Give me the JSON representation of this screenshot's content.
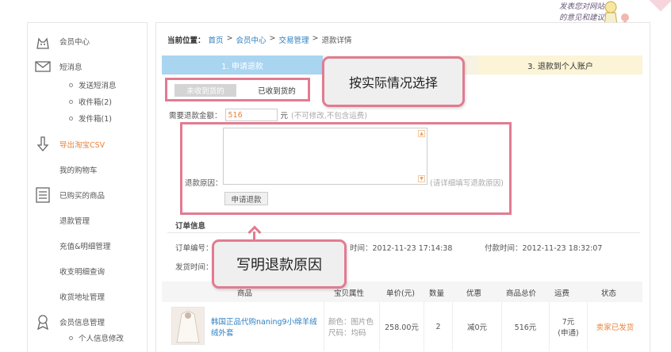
{
  "feedback": {
    "line1": "发表您对网站",
    "line2": "的意见和建议"
  },
  "sidebar": {
    "member_center": "会员中心",
    "messages": "短消息",
    "msg_sent": "发送短消息",
    "msg_inbox": "收件箱(2)",
    "msg_outbox": "发件箱(1)",
    "export_csv": "导出淘宝CSV",
    "cart": "我的购物车",
    "bought": "已购买的商品",
    "refund_manage": "退款管理",
    "recharge": "充值&明细管理",
    "payments": "收支明细查询",
    "address": "收货地址管理",
    "profile": "会员信息管理",
    "profile_edit": "个人信息修改"
  },
  "breadcrumb": {
    "label": "当前位置：",
    "home": "首页",
    "member": "会员中心",
    "trade": "交易管理",
    "current": "退款详情",
    "sep": ">"
  },
  "steps": {
    "step1": "1. 申请退款",
    "step3": "3. 退款到个人账户"
  },
  "tabs": {
    "not_received": "未收到货的",
    "received": "已收到货的"
  },
  "callouts": {
    "choose": "按实际情况选择",
    "reason": "写明退款原因"
  },
  "refund": {
    "amount_label": "需要退款金额：",
    "amount_value": "516",
    "unit": "元",
    "amount_note": "(不可修改,不包含运费)",
    "reason_label": "退款原因：",
    "reason_hint": "(请详细填写退款原因)",
    "submit": "申请退款"
  },
  "order": {
    "title": "订单信息",
    "number_label": "订单编号：",
    "created_time": "时间：2012-11-23 17:14:38",
    "paid_time": "付款时间：2012-11-23 18:32:07",
    "ship_label": "发货时间："
  },
  "table": {
    "headers": [
      "商品",
      "宝贝属性",
      "单价(元)",
      "数量",
      "优惠",
      "商品总价",
      "运费",
      "状态"
    ],
    "rows": [
      {
        "name": "韩国正品代购naning9小绵羊绒绒外套",
        "attr1": "颜色：图片色",
        "attr2": "尺码：均码",
        "price": "258.00元",
        "qty": "2",
        "discount": "减0元",
        "total": "516元",
        "shipping1": "7元",
        "shipping2": "(申通)",
        "status": "卖家已发货"
      }
    ]
  },
  "colors": {
    "accent_pink": "#e27b92",
    "link_blue": "#2d7fc1",
    "orange": "#e8833a",
    "step_blue": "#a9d5f1"
  }
}
